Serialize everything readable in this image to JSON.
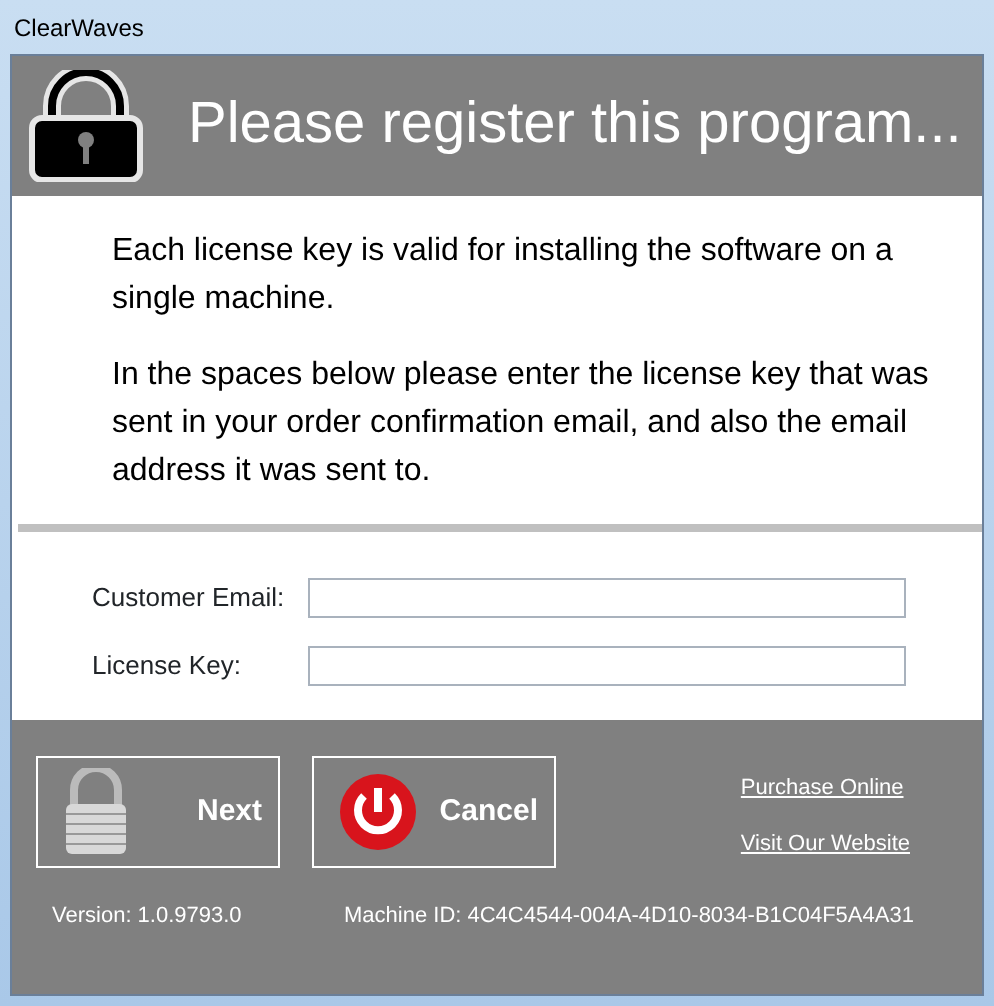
{
  "window": {
    "title": "ClearWaves"
  },
  "header": {
    "title": "Please register this program..."
  },
  "paragraphs": [
    "Each license key is valid for installing the software on a single machine.",
    "In the spaces below please enter the license key that was sent in your order confirmation email, and also the email address it was sent to."
  ],
  "fields": [
    {
      "label": "Customer Email:"
    },
    {
      "label": "License Key:"
    }
  ],
  "buttons": [
    {
      "kind": "next",
      "label": "Next"
    },
    {
      "kind": "cancel",
      "label": "Cancel"
    }
  ],
  "links": [
    "Purchase Online",
    "Visit Our Website"
  ],
  "version": "Version: 1.0.9793.0",
  "machine_id": "Machine ID: 4C4C4544-004A-4D10-8034-B1C04F5A4A31"
}
